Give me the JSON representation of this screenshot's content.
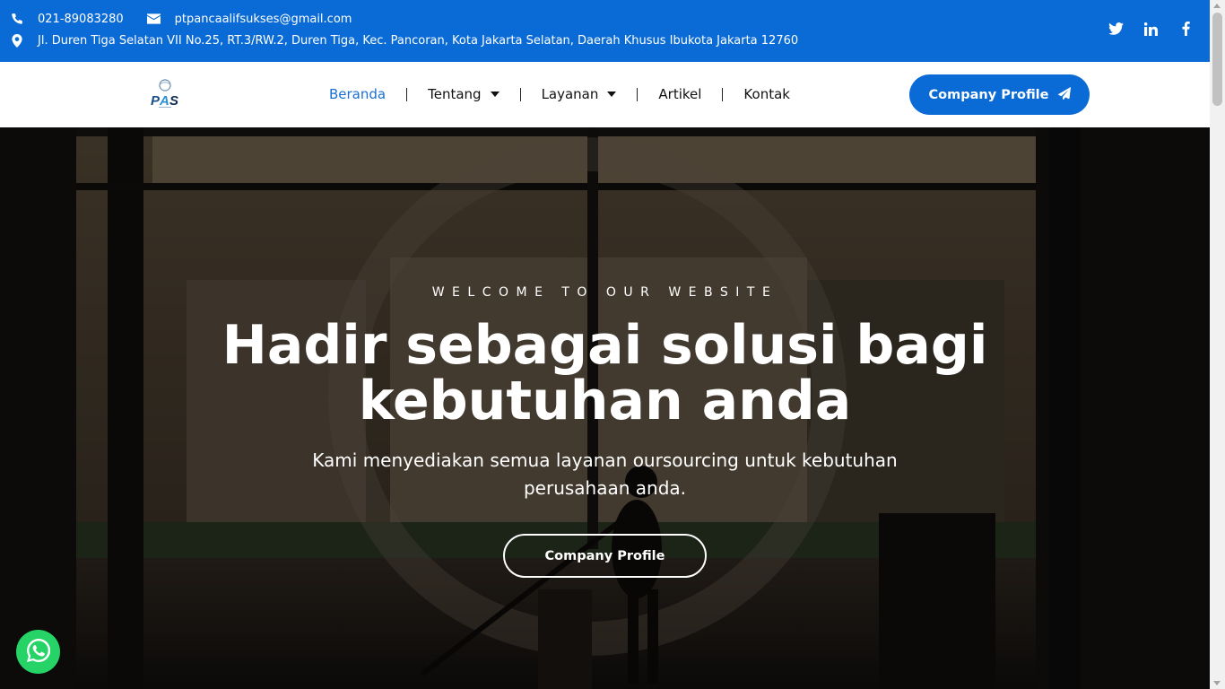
{
  "topbar": {
    "phone": "021-89083280",
    "email": "ptpancaalifsukses@gmail.com",
    "address": "Jl. Duren Tiga Selatan VII No.25, RT.3/RW.2, Duren Tiga, Kec. Pancoran, Kota Jakarta Selatan, Daerah Khusus Ibukota Jakarta 12760",
    "background_color": "#0a6bd6",
    "icons": [
      "phone-icon",
      "envelope-icon",
      "map-marker-icon"
    ],
    "social_icons": [
      "twitter-icon",
      "linkedin-icon",
      "facebook-icon"
    ]
  },
  "nav": {
    "logo_text": "PAS",
    "items": [
      {
        "label": "Beranda",
        "active": true
      },
      {
        "label": "Tentang",
        "dropdown": true
      },
      {
        "label": "Layanan",
        "dropdown": true
      },
      {
        "label": "Artikel"
      },
      {
        "label": "Kontak"
      }
    ],
    "cta_label": "Company Profile",
    "accent_color": "#0a6bd6"
  },
  "hero": {
    "eyebrow": "WELCOME TO OUR WEBSITE",
    "title_line1": "Hadir sebagai solusi bagi",
    "title_line2": "kebutuhan anda",
    "subtitle": "Kami menyediakan semua layanan oursourcing untuk kebutuhan perusahaan anda.",
    "button_label": "Company Profile"
  },
  "floating": {
    "whatsapp_icon": "whatsapp-icon",
    "whatsapp_color": "#25d366"
  }
}
